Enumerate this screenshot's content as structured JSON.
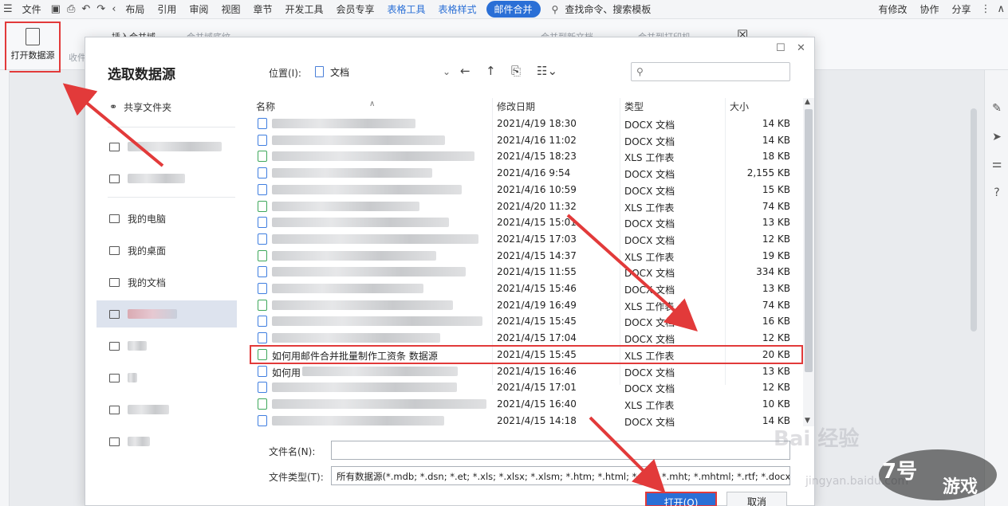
{
  "menubar": {
    "file": "文件",
    "tabs": [
      "布局",
      "引用",
      "审阅",
      "视图",
      "章节",
      "开发工具",
      "会员专享"
    ],
    "blue_tabs": [
      "表格工具",
      "表格样式"
    ],
    "active_tab": "邮件合并",
    "search": "查找命令、搜索模板",
    "modified": "有修改",
    "collab": "协作",
    "share": "分享"
  },
  "ribbon": {
    "open_data_source": "打开数据源",
    "favorites": "收件",
    "insert_merge_field": "插入合并域",
    "merge_field_shading": "合并域底纹",
    "merge_to_new_doc": "合并到新文档",
    "merge_to_printer": "合并到打印机"
  },
  "dialog": {
    "title": "选取数据源",
    "location_label": "位置(I):",
    "location_value": "文档",
    "sidebar": [
      {
        "label": "共享文件夹",
        "icon": "share-folder-icon"
      },
      {
        "label": "",
        "icon": "building-icon"
      },
      {
        "label": "",
        "icon": "building-icon"
      },
      {
        "label": "我的电脑",
        "icon": "computer-icon"
      },
      {
        "label": "我的桌面",
        "icon": "desktop-icon"
      },
      {
        "label": "我的文档",
        "icon": "folder-icon"
      },
      {
        "label": "",
        "icon": "folder-icon"
      },
      {
        "label": "",
        "icon": "folder-icon"
      },
      {
        "label": "",
        "icon": "folder-icon"
      },
      {
        "label": "",
        "icon": "folder-icon"
      },
      {
        "label": "",
        "icon": "folder-icon"
      }
    ],
    "columns": {
      "name": "名称",
      "date": "修改日期",
      "type": "类型",
      "size": "大小"
    },
    "files": [
      {
        "name": "",
        "date": "2021/4/19 18:30",
        "type": "DOCX 文档",
        "size": "14 KB",
        "kind": "docx"
      },
      {
        "name": "",
        "date": "2021/4/16 11:02",
        "type": "DOCX 文档",
        "size": "14 KB",
        "kind": "docx"
      },
      {
        "name": "",
        "date": "2021/4/15 18:23",
        "type": "XLS 工作表",
        "size": "18 KB",
        "kind": "xls"
      },
      {
        "name": "",
        "date": "2021/4/16 9:54",
        "type": "DOCX 文档",
        "size": "2,155 KB",
        "kind": "docx"
      },
      {
        "name": "",
        "date": "2021/4/16 10:59",
        "type": "DOCX 文档",
        "size": "15 KB",
        "kind": "docx"
      },
      {
        "name": "",
        "date": "2021/4/20 11:32",
        "type": "XLS 工作表",
        "size": "74 KB",
        "kind": "xls"
      },
      {
        "name": "",
        "date": "2021/4/15 15:01",
        "type": "DOCX 文档",
        "size": "13 KB",
        "kind": "docx"
      },
      {
        "name": "",
        "date": "2021/4/15 17:03",
        "type": "DOCX 文档",
        "size": "12 KB",
        "kind": "docx"
      },
      {
        "name": "",
        "date": "2021/4/15 14:37",
        "type": "XLS 工作表",
        "size": "19 KB",
        "kind": "xls"
      },
      {
        "name": "",
        "date": "2021/4/15 11:55",
        "type": "DOCX 文档",
        "size": "334 KB",
        "kind": "docx"
      },
      {
        "name": "",
        "date": "2021/4/15 15:46",
        "type": "DOCX 文档",
        "size": "13 KB",
        "kind": "docx"
      },
      {
        "name": "",
        "date": "2021/4/19 16:49",
        "type": "XLS 工作表",
        "size": "74 KB",
        "kind": "xls"
      },
      {
        "name": "",
        "date": "2021/4/15 15:45",
        "type": "DOCX 文档",
        "size": "16 KB",
        "kind": "docx"
      },
      {
        "name": "",
        "date": "2021/4/15 17:04",
        "type": "DOCX 文档",
        "size": "12 KB",
        "kind": "docx"
      },
      {
        "name": "如何用邮件合并批量制作工资条 数据源",
        "date": "2021/4/15 15:45",
        "type": "XLS 工作表",
        "size": "20 KB",
        "kind": "xls",
        "highlight": true
      },
      {
        "name": "如何用",
        "date": "2021/4/15 16:46",
        "type": "DOCX 文档",
        "size": "13 KB",
        "kind": "docx"
      },
      {
        "name": "",
        "date": "2021/4/15 17:01",
        "type": "DOCX 文档",
        "size": "12 KB",
        "kind": "docx"
      },
      {
        "name": "",
        "date": "2021/4/15 16:40",
        "type": "XLS 工作表",
        "size": "10 KB",
        "kind": "xls"
      },
      {
        "name": "",
        "date": "2021/4/15 14:18",
        "type": "DOCX 文档",
        "size": "14 KB",
        "kind": "docx"
      }
    ],
    "filename_label": "文件名(N):",
    "filename_value": "",
    "filetype_label": "文件类型(T):",
    "filetype_value": "所有数据源(*.mdb; *.dsn; *.et; *.xls; *.xlsx; *.xlsm; *.htm; *.html; *.asp; *.mht; *.mhtml; *.rtf; *.docx; *.doc; *.",
    "open_button": "打开(O)",
    "cancel_button": "取消"
  },
  "watermark": {
    "baidu": "Bai 经验",
    "site": "jingyan.baidu.com",
    "logo_text": "游戏",
    "logo_number": "7号"
  }
}
